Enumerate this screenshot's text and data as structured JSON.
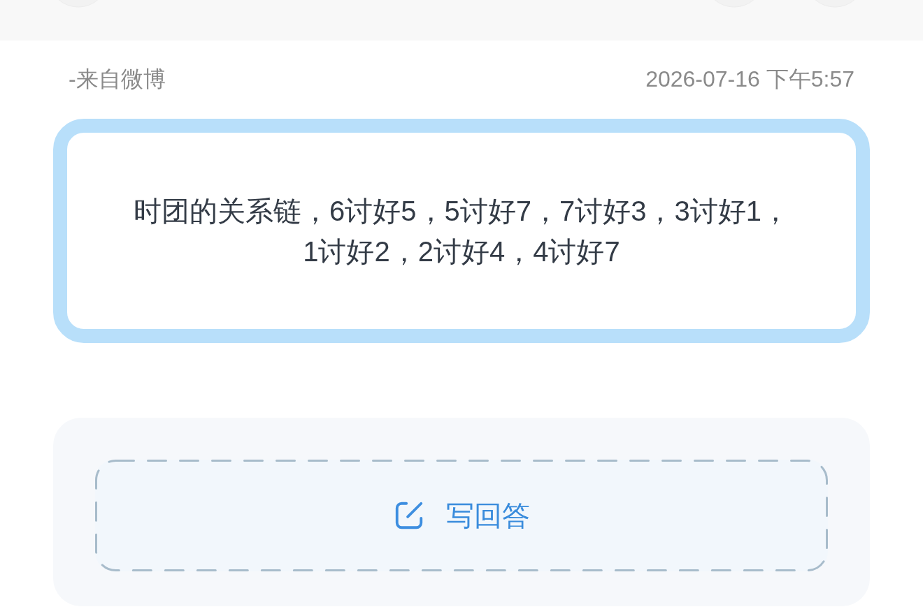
{
  "source": "-来自微博",
  "timestamp": "2026-07-16 下午5:57",
  "quote_card": {
    "text": "时团的关系链，6讨好5，5讨好7，7讨好3，3讨好1，1讨好2，2讨好4，4讨好7"
  },
  "answer_button": {
    "label": "写回答"
  }
}
